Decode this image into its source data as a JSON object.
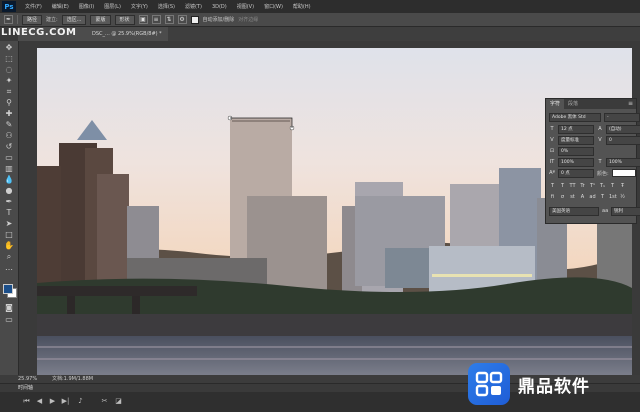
{
  "app": {
    "logo": "Ps"
  },
  "menu": [
    "文件(F)",
    "编辑(E)",
    "图像(I)",
    "图层(L)",
    "文字(Y)",
    "选择(S)",
    "滤镜(T)",
    "3D(D)",
    "视图(V)",
    "窗口(W)",
    "帮助(H)"
  ],
  "options": {
    "tool_icon": "move-tool-icon",
    "mode_select": "路径",
    "create_label": "建立:",
    "selection_btn": "选区...",
    "mask_btn": "蒙版",
    "shape_btn": "形状",
    "auto_add_delete": "自动添加/删除",
    "align_edges": "对齐边缘"
  },
  "document": {
    "tab_title": "DSC_... @ 25.9%(RGB/8#) *"
  },
  "watermark": "LINECG.COM",
  "character_panel": {
    "tabs": [
      "字符",
      "段落"
    ],
    "font_family": "Adobe 黑体 Std",
    "font_style": "-",
    "font_size": "12 点",
    "leading": "(自动)",
    "kerning": "度量标准",
    "tracking": "0",
    "scale_pct": "0%",
    "vertical_scale": "100%",
    "horizontal_scale": "100%",
    "baseline": "0 点",
    "color_label": "颜色:",
    "language": "美国英语",
    "antialias": "锐利",
    "style_buttons": [
      "T",
      "T",
      "TT",
      "Tr",
      "T¹",
      "T₁",
      "T",
      "Ŧ"
    ],
    "opentype_buttons": [
      "fi",
      "σ",
      "st",
      "A",
      "ad",
      "T",
      "1st",
      "½"
    ]
  },
  "status": {
    "zoom": "25.97%",
    "doc_info": "文档:1.9M/1.88M"
  },
  "timeline": {
    "title": "时间轴"
  },
  "brand": {
    "name": "鼎品软件"
  },
  "colors": {
    "foreground": "#1c4f8a",
    "background": "#ffffff",
    "brand": "#2e7de9"
  }
}
